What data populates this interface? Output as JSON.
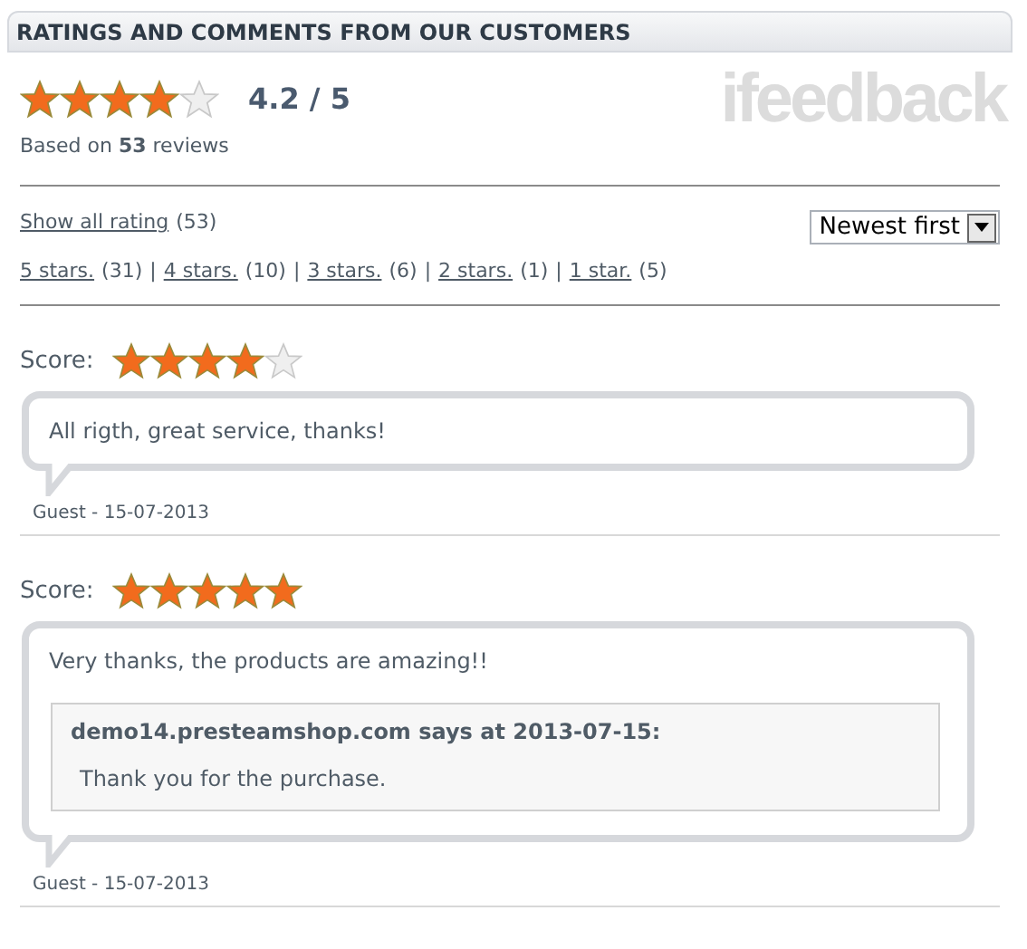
{
  "header": {
    "title": "RATINGS AND COMMENTS FROM OUR CUSTOMERS"
  },
  "summary": {
    "stars": 4,
    "score": "4.2 / 5",
    "based_on": "Based on **53** reviews",
    "logo": "ifeedback"
  },
  "show_all": {
    "label": "Show all rating",
    "count": "(53)"
  },
  "sort": {
    "value": "Newest first"
  },
  "filters": [
    {
      "label": "5 stars.",
      "count": "(31)",
      "separator": "|"
    },
    {
      "label": "4 stars.",
      "count": "(10)",
      "separator": "|"
    },
    {
      "label": "3 stars.",
      "count": "(6)",
      "separator": "|"
    },
    {
      "label": "2 stars.",
      "count": "(1)",
      "separator": "|"
    },
    {
      "label": "1 star.",
      "count": "(5)"
    }
  ],
  "reviews": [
    {
      "score_label": "Score:",
      "stars": 4,
      "comment": "All rigth, great service, thanks!",
      "author": "Guest - 15-07-2013"
    },
    {
      "score_label": "Score:",
      "stars": 5,
      "comment": "Very thanks, the products are amazing!!",
      "reply": {
        "title": "demo14.presteamshop.com says at 2013-07-15:",
        "text": "Thank you for the purchase."
      },
      "author": "Guest - 15-07-2013"
    }
  ]
}
